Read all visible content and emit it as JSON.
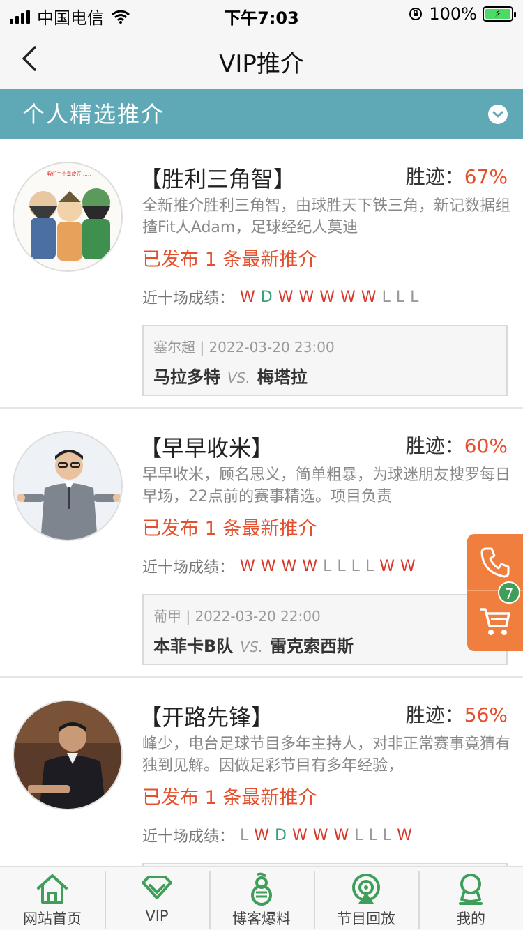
{
  "status_bar": {
    "carrier": "中国电信",
    "time": "下午7:03",
    "battery": "100%"
  },
  "nav": {
    "title": "VIP推介"
  },
  "section": {
    "title": "个人精选推介"
  },
  "common": {
    "win_rate_label": "胜迹：",
    "record_label": "近十场成绩：",
    "vs_label": "VS."
  },
  "experts": [
    {
      "name": "【胜利三角智】",
      "win_rate": "67%",
      "description": "全新推介胜利三角智，由球胜天下铁三角，新记数据组揸Fit人Adam，足球经纪人莫迪",
      "published": "已发布 1 条最新推介",
      "record": [
        "W",
        "D",
        "W",
        "W",
        "W",
        "W",
        "W",
        "L",
        "L",
        "L"
      ],
      "match": {
        "league_time": "塞尔超 | 2022-03-20 23:00",
        "home": "马拉多特",
        "away": "梅塔拉"
      }
    },
    {
      "name": "【早早收米】",
      "win_rate": "60%",
      "description": "早早收米，顾名思义，简单粗暴，为球迷朋友搜罗每日早场，22点前的赛事精选。项目负责",
      "published": "已发布 1 条最新推介",
      "record": [
        "W",
        "W",
        "W",
        "W",
        "L",
        "L",
        "L",
        "L",
        "W",
        "W"
      ],
      "match": {
        "league_time": "葡甲 | 2022-03-20 22:00",
        "home": "本菲卡B队",
        "away": "雷克索西斯"
      }
    },
    {
      "name": "【开路先锋】",
      "win_rate": "56%",
      "description": "峰少，电台足球节目多年主持人，对非正常赛事竟猜有独到见解。因做足彩节目有多年经验，",
      "published": "已发布 1 条最新推介",
      "record": [
        "L",
        "W",
        "D",
        "W",
        "W",
        "W",
        "L",
        "L",
        "L",
        "W"
      ],
      "match": {
        "league_time": "",
        "home": "",
        "away": ""
      }
    }
  ],
  "floating": {
    "cart_count": "7"
  },
  "tabs": [
    {
      "label": "网站首页",
      "icon": "home-icon"
    },
    {
      "label": "VIP",
      "icon": "vip-diamond-icon"
    },
    {
      "label": "博客爆料",
      "icon": "blog-gourd-icon"
    },
    {
      "label": "节目回放",
      "icon": "replay-icon"
    },
    {
      "label": "我的",
      "icon": "profile-icon"
    }
  ],
  "colors": {
    "accent_teal": "#5fa9b7",
    "highlight_red": "#e4502d",
    "win_red": "#d8392b",
    "draw_green": "#3aa37a",
    "tab_green": "#3f9f5a",
    "float_orange": "#f07f3f"
  }
}
